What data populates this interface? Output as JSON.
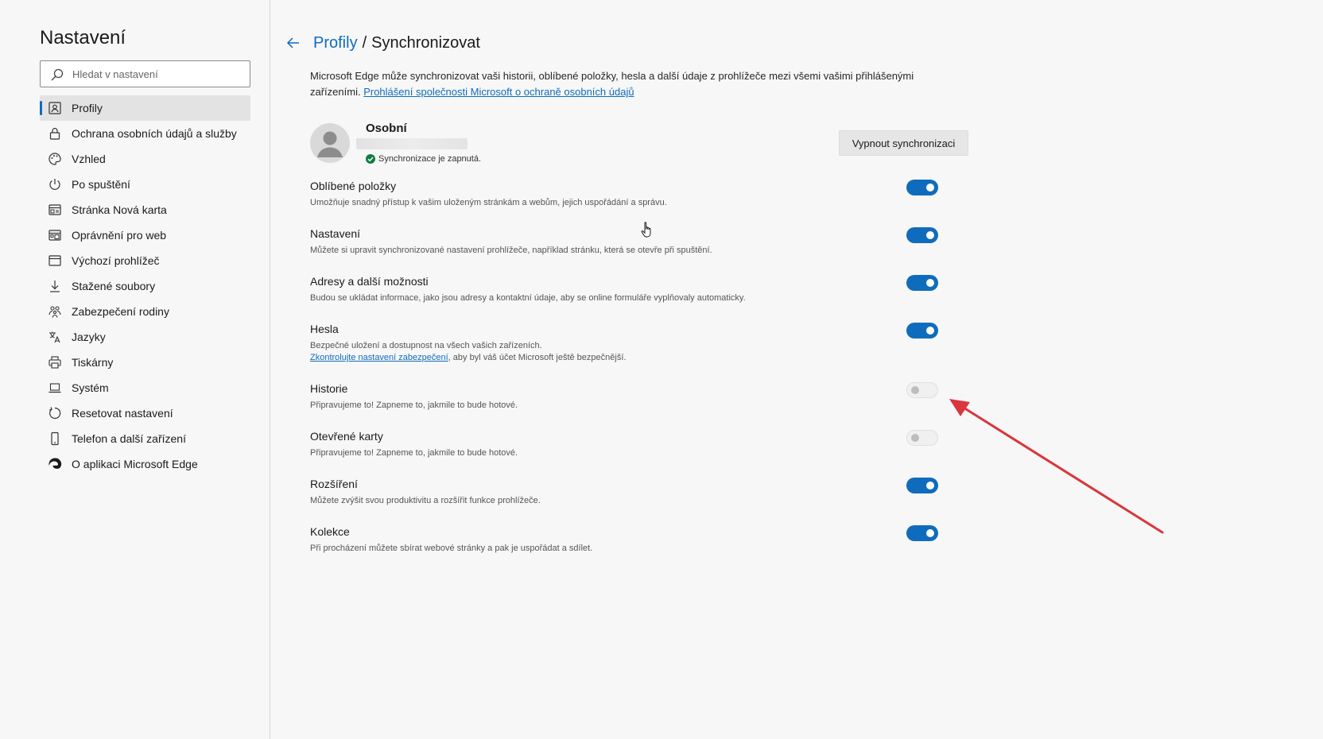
{
  "sidebar": {
    "title": "Nastavení",
    "search_placeholder": "Hledat v nastavení",
    "items": [
      {
        "label": "Profily",
        "icon": "profile-icon",
        "active": true
      },
      {
        "label": "Ochrana osobních údajů a služby",
        "icon": "lock-icon"
      },
      {
        "label": "Vzhled",
        "icon": "palette-icon"
      },
      {
        "label": "Po spuštění",
        "icon": "power-icon"
      },
      {
        "label": "Stránka Nová karta",
        "icon": "newtab-icon"
      },
      {
        "label": "Oprávnění pro web",
        "icon": "site-permissions-icon"
      },
      {
        "label": "Výchozí prohlížeč",
        "icon": "browser-icon"
      },
      {
        "label": "Stažené soubory",
        "icon": "download-icon"
      },
      {
        "label": "Zabezpečení rodiny",
        "icon": "family-icon"
      },
      {
        "label": "Jazyky",
        "icon": "language-icon"
      },
      {
        "label": "Tiskárny",
        "icon": "printer-icon"
      },
      {
        "label": "Systém",
        "icon": "laptop-icon"
      },
      {
        "label": "Resetovat nastavení",
        "icon": "reset-icon"
      },
      {
        "label": "Telefon a další zařízení",
        "icon": "phone-icon"
      },
      {
        "label": "O aplikaci Microsoft Edge",
        "icon": "edge-icon"
      }
    ]
  },
  "header": {
    "back_icon": "back-arrow-icon",
    "crumb_link": "Profily",
    "separator": "/",
    "current": "Synchronizovat"
  },
  "intro": {
    "text": "Microsoft Edge může synchronizovat vaši historii, oblíbené položky, hesla a další údaje z prohlížeče mezi všemi vašimi přihlášenými zařízeními.",
    "link": "Prohlášení společnosti Microsoft o ochraně osobních údajů"
  },
  "profile": {
    "name": "Osobní",
    "status": "Synchronizace je zapnutá.",
    "sync_off_label": "Vypnout synchronizaci"
  },
  "sync_items": [
    {
      "title": "Oblíbené položky",
      "desc": "Umožňuje snadný přístup k vašim uloženým stránkám a webům, jejich uspořádání a správu.",
      "on": true
    },
    {
      "title": "Nastavení",
      "desc": "Můžete si upravit synchronizované nastavení prohlížeče, například stránku, která se otevře při spuštění.",
      "on": true
    },
    {
      "title": "Adresy a další možnosti",
      "desc": "Budou se ukládat informace, jako jsou adresy a kontaktní údaje, aby se online formuláře vyplňovaly automaticky.",
      "on": true
    },
    {
      "title": "Hesla",
      "desc": "Bezpečné uložení a dostupnost na všech vašich zařízeních.",
      "link": "Zkontrolujte nastavení zabezpečení",
      "desc2": ", aby byl váš účet Microsoft ještě bezpečnější.",
      "on": true
    },
    {
      "title": "Historie",
      "desc": "Připravujeme to! Zapneme to, jakmile to bude hotové.",
      "on": false
    },
    {
      "title": "Otevřené karty",
      "desc": "Připravujeme to! Zapneme to, jakmile to bude hotové.",
      "on": false
    },
    {
      "title": "Rozšíření",
      "desc": "Můžete zvýšit svou produktivitu a rozšířit funkce prohlížeče.",
      "on": true
    },
    {
      "title": "Kolekce",
      "desc": "Při procházení můžete sbírat webové stránky a pak je uspořádat a sdílet.",
      "on": true
    }
  ],
  "colors": {
    "accent": "#0f6cbd",
    "annotation_arrow": "#d9363e",
    "sync_ok": "#107c41"
  }
}
